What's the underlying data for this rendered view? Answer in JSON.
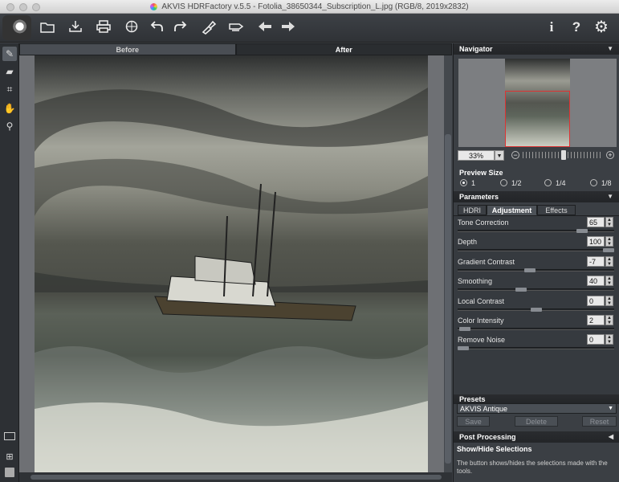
{
  "window": {
    "title": "AKVIS HDRFactory v.5.5 - Fotolia_38650344_Subscription_L.jpg (RGB/8, 2019x2832)"
  },
  "toolbar": {
    "icons": [
      "open-icon",
      "save-icon",
      "print-icon",
      "share-icon",
      "undo-icon",
      "redo-icon",
      "run-icon",
      "batch-icon",
      "back-icon",
      "forward-icon",
      "info-icon",
      "help-icon",
      "settings-icon"
    ]
  },
  "view_tabs": {
    "before": "Before",
    "after": "After"
  },
  "navigator": {
    "title": "Navigator",
    "zoom": "33%"
  },
  "preview_size": {
    "title": "Preview Size",
    "options": [
      "1",
      "1/2",
      "1/4",
      "1/8"
    ],
    "selected": "1"
  },
  "parameters": {
    "title": "Parameters",
    "tabs": [
      "HDRI",
      "Adjustment",
      "Effects"
    ],
    "active_tab": "Adjustment",
    "items": [
      {
        "label": "Tone Correction",
        "value": "65",
        "fraction": 0.82
      },
      {
        "label": "Depth",
        "value": "100",
        "fraction": 1.0
      },
      {
        "label": "Gradient Contrast",
        "value": "-7",
        "fraction": 0.46
      },
      {
        "label": "Smoothing",
        "value": "40",
        "fraction": 0.4
      },
      {
        "label": "Local Contrast",
        "value": "0",
        "fraction": 0.5
      },
      {
        "label": "Color Intensity",
        "value": "2",
        "fraction": 0.01
      },
      {
        "label": "Remove Noise",
        "value": "0",
        "fraction": 0.0
      }
    ]
  },
  "presets": {
    "title": "Presets",
    "selected": "AKVIS Antique",
    "save": "Save",
    "delete": "Delete",
    "reset": "Reset"
  },
  "post_processing": {
    "title": "Post Processing"
  },
  "hint": {
    "title": "Show/Hide Selections",
    "text": "The button shows/hides the selections made with the tools."
  }
}
